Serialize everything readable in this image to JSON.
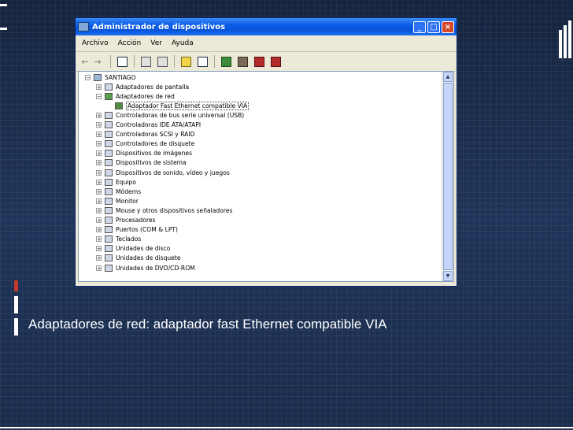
{
  "window": {
    "title": "Administrador de dispositivos",
    "minimize": "_",
    "maximize": "□",
    "close": "×"
  },
  "menu": [
    "Archivo",
    "Acción",
    "Ver",
    "Ayuda"
  ],
  "toolbar": {
    "back": "←",
    "forward": "→",
    "icons": [
      "properties-icon",
      "update-icon",
      "help-icon",
      "scan-icon",
      "device-icon",
      "disable-icon",
      "uninstall-icon",
      "printer-icon"
    ]
  },
  "tree": {
    "root": "SANTIAGO",
    "categories": [
      {
        "label": "Adaptadores de pantalla",
        "expanded": false
      },
      {
        "label": "Adaptadores de red",
        "expanded": true,
        "children": [
          "Adaptador Fast Ethernet compatible VIA"
        ]
      },
      {
        "label": "Controladoras de bus serie universal (USB)",
        "expanded": false
      },
      {
        "label": "Controladoras IDE ATA/ATAPI",
        "expanded": false
      },
      {
        "label": "Controladoras SCSI y RAID",
        "expanded": false
      },
      {
        "label": "Controladores de disquete",
        "expanded": false
      },
      {
        "label": "Dispositivos de imágenes",
        "expanded": false
      },
      {
        "label": "Dispositivos de sistema",
        "expanded": false
      },
      {
        "label": "Dispositivos de sonido, vídeo y juegos",
        "expanded": false
      },
      {
        "label": "Equipo",
        "expanded": false
      },
      {
        "label": "Módems",
        "expanded": false
      },
      {
        "label": "Monitor",
        "expanded": false
      },
      {
        "label": "Mouse y otros dispositivos señaladores",
        "expanded": false
      },
      {
        "label": "Procesadores",
        "expanded": false
      },
      {
        "label": "Puertos (COM & LPT)",
        "expanded": false
      },
      {
        "label": "Teclados",
        "expanded": false
      },
      {
        "label": "Unidades de disco",
        "expanded": false
      },
      {
        "label": "Unidades de disquete",
        "expanded": false
      },
      {
        "label": "Unidades de DVD/CD-ROM",
        "expanded": false
      }
    ]
  },
  "caption": "Adaptadores de red: adaptador fast Ethernet compatible VIA"
}
